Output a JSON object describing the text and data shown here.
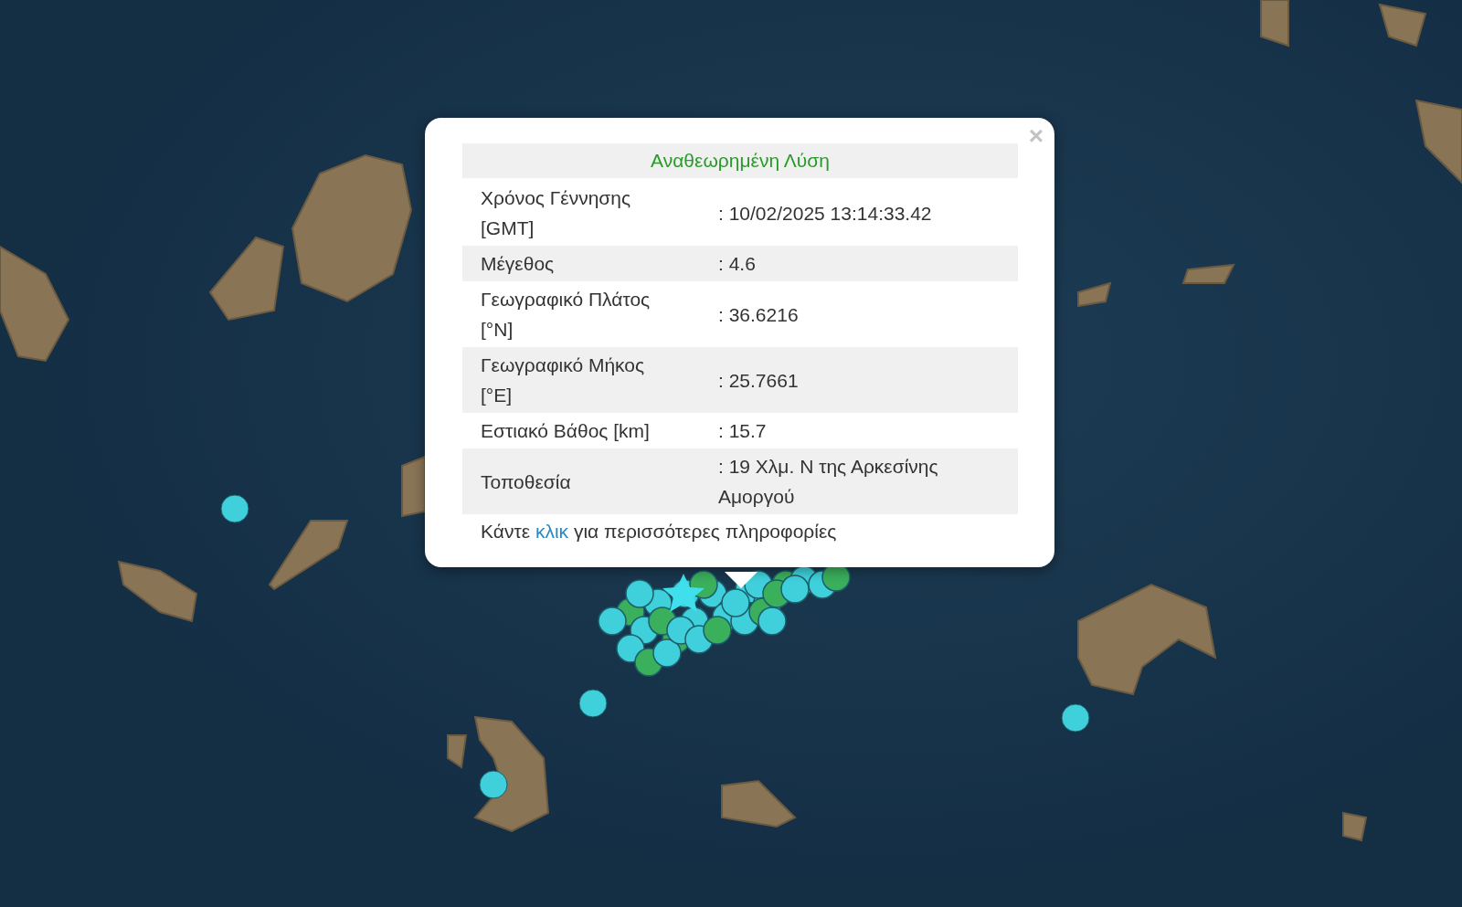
{
  "popup": {
    "close": "×",
    "title": "Αναθεωρημένη Λύση",
    "rows": [
      {
        "label": "Χρόνος Γέννησης\n[GMT]",
        "value": ": 10/02/2025 13:14:33.42"
      },
      {
        "label": "Μέγεθος",
        "value": ": 4.6"
      },
      {
        "label": "Γεωγραφικό Πλάτος\n[°N]",
        "value": ": 36.6216"
      },
      {
        "label": "Γεωγραφικό Μήκος\n[°E]",
        "value": ": 25.7661"
      },
      {
        "label": "Εστιακό Βάθος [km]",
        "value": ": 15.7"
      },
      {
        "label": "Τοποθεσία",
        "value": ": 19 Χλμ. Ν της Αρκεσίνης Αμοργού"
      }
    ],
    "footer": {
      "before": "Κάντε",
      "link": "κλικ",
      "after": "για περισσότερες πληροφορίες"
    }
  }
}
